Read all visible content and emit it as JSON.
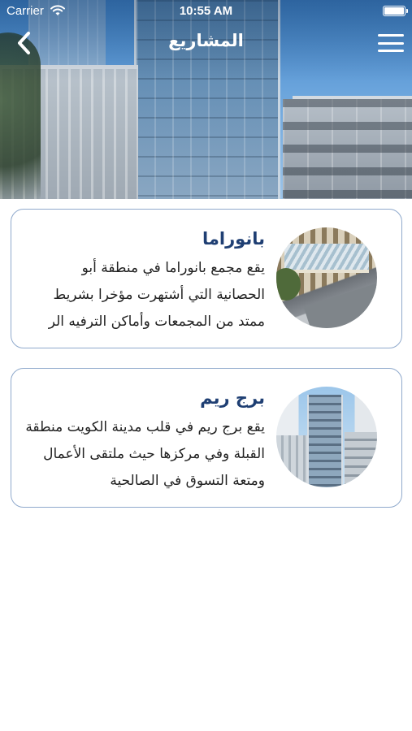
{
  "status_bar": {
    "carrier": "Carrier",
    "time": "10:55 AM"
  },
  "nav": {
    "title": "المشاريع",
    "back_icon": "chevron-left-icon",
    "menu_icon": "hamburger-menu-icon"
  },
  "projects": [
    {
      "title": "بانوراما",
      "description": "يقع مجمع بانوراما في منطقة أبو\nالحصانية التي  أشتهرت مؤخرا بشريط\nممتد من المجمعات وأماكن الترفيه الر",
      "image": "panorama-complex-photo"
    },
    {
      "title": "برج ريم",
      "description": "يقع برج ريم في قلب مدينة الكويت منطقة\nالقبلة  وفي مركزها حيث ملتقى الأعمال\nومتعة التسوق في الصالحية",
      "image": "reem-tower-photo"
    }
  ],
  "colors": {
    "card_border": "#8fa9cc",
    "title_blue": "#1f3f73"
  }
}
